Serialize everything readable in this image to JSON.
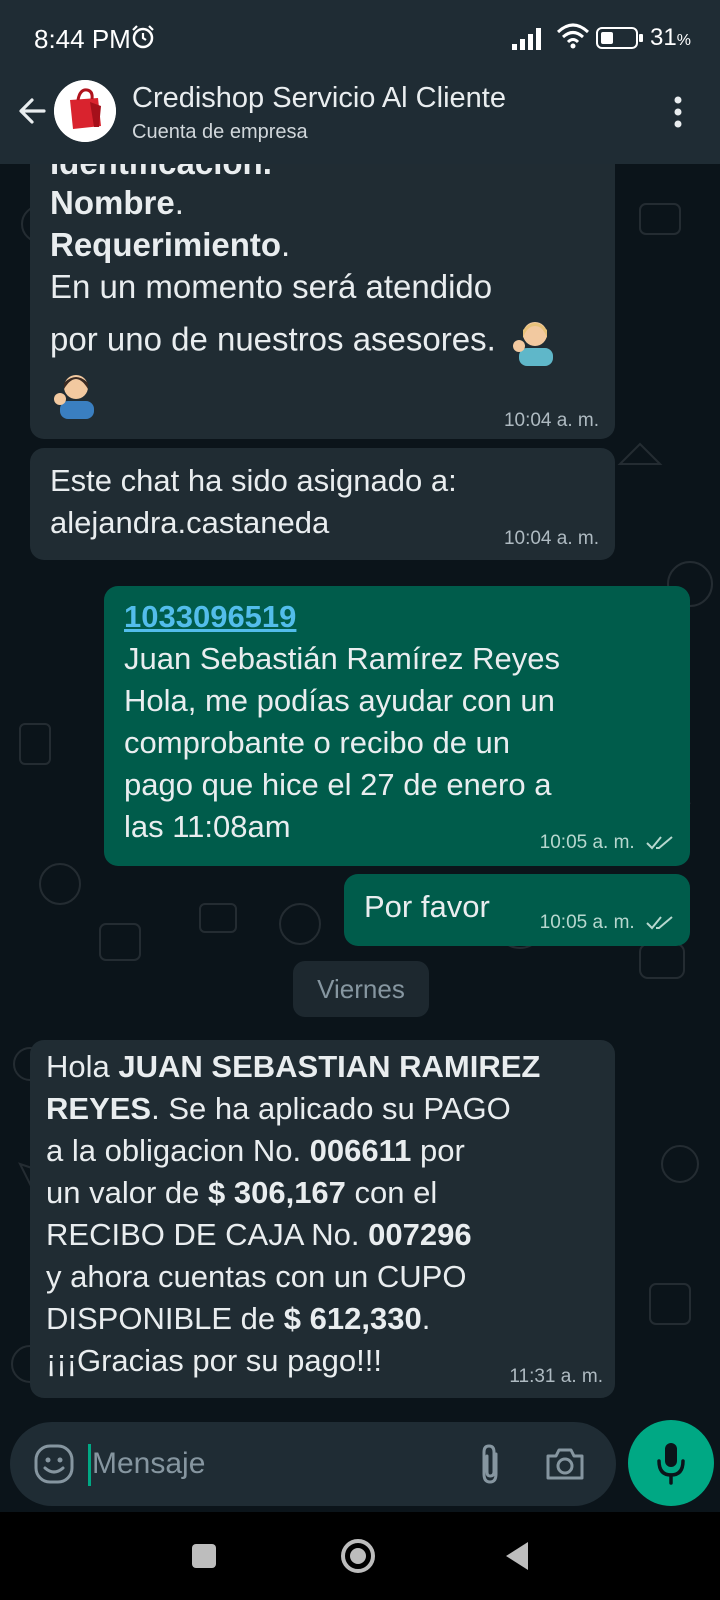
{
  "status_bar": {
    "time": "8:44 PM",
    "battery": "31"
  },
  "header": {
    "contact_name": "Credishop Servicio Al Cliente",
    "subtitle": "Cuenta de empresa"
  },
  "messages": {
    "m1": {
      "partial_line": "Identificación.",
      "line_name": "Nombre",
      "line_req": "Requerimiento",
      "period": ".",
      "line_wait1": "En un momento será atendido",
      "line_wait2": "por uno de nuestros asesores.",
      "time": "10:04 a. m."
    },
    "m2": {
      "line1": "Este chat ha sido asignado a:",
      "line2": "alejandra.castaneda",
      "time": "10:04 a. m."
    },
    "m3": {
      "id_link": "1033096519",
      "line1": "Juan Sebastián Ramírez Reyes",
      "line2": "Hola, me podías ayudar con un",
      "line3": "comprobante o recibo de un",
      "line4": "pago que hice el 27 de enero a",
      "line5": "las 11:08am",
      "time": "10:05 a. m."
    },
    "m4": {
      "text": "Por favor",
      "time": "10:05 a. m."
    },
    "day_separator": "Viernes",
    "m5": {
      "hola": "Hola ",
      "name1": "JUAN SEBASTIAN RAMIREZ",
      "name2": "REYES",
      "after_name": ". Se ha aplicado su PAGO",
      "line3a": "a la obligacion No. ",
      "obligation": "006611",
      "line3b": " por",
      "line4a": "un valor de ",
      "amount": "$ 306,167",
      "line4b": " con el",
      "line5a": "RECIBO DE CAJA No. ",
      "receipt": "007296",
      "line6": "y ahora cuentas con un CUPO",
      "line7a": "DISPONIBLE de ",
      "cupo": "$ 612,330",
      "line7b": ".",
      "line8": "¡¡¡Gracias por su pago!!!",
      "time": "11:31 a. m."
    }
  },
  "input": {
    "placeholder": "Mensaje"
  },
  "colors": {
    "header_bg": "#1f2c34",
    "chat_bg": "#0b141a",
    "incoming_bubble": "#202c33",
    "outgoing_bubble": "#005c4b",
    "accent": "#00a884",
    "link": "#53bdeb"
  },
  "icons": [
    "back-arrow-icon",
    "shop-bag-avatar",
    "more-vert-icon",
    "emoji-icon",
    "attach-icon",
    "camera-icon",
    "mic-icon",
    "double-check-icon"
  ]
}
